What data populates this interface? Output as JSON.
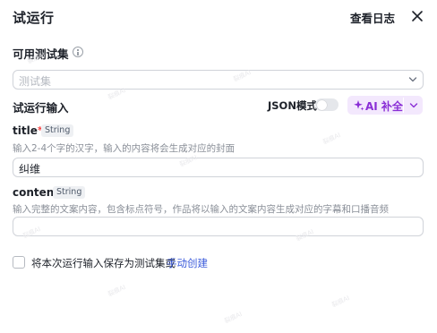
{
  "header": {
    "title": "试运行",
    "logs_label": "查看日志",
    "close_glyph": "✕"
  },
  "dataset": {
    "label": "可用测试集",
    "placeholder": "测试集"
  },
  "input_section": {
    "label": "试运行输入",
    "json_mode_label": "JSON模式",
    "json_mode_enabled": false,
    "ai_button_label": "AI 补全"
  },
  "fields": [
    {
      "name": "title",
      "required_mark": "*",
      "type": "String",
      "hint": "输入2-4个字的汉字，输入的内容将会生成对应的封面",
      "value": "纠维"
    },
    {
      "name": "content",
      "type": "String",
      "hint": "输入完整的文案内容，包含标点符号，作品将以输入的文案内容生成对应的字幕和口播音频",
      "value": ""
    }
  ],
  "save_option": {
    "checked": false,
    "label": "将本次运行输入保存为测试集或",
    "link": "手动创建"
  },
  "watermark": "裂痕AI",
  "colors": {
    "accent_purple": "#8a2ed6",
    "ai_button_bg": "#f3e8fd",
    "link_blue": "#3b5bdb",
    "required_red": "#f53f3f"
  }
}
